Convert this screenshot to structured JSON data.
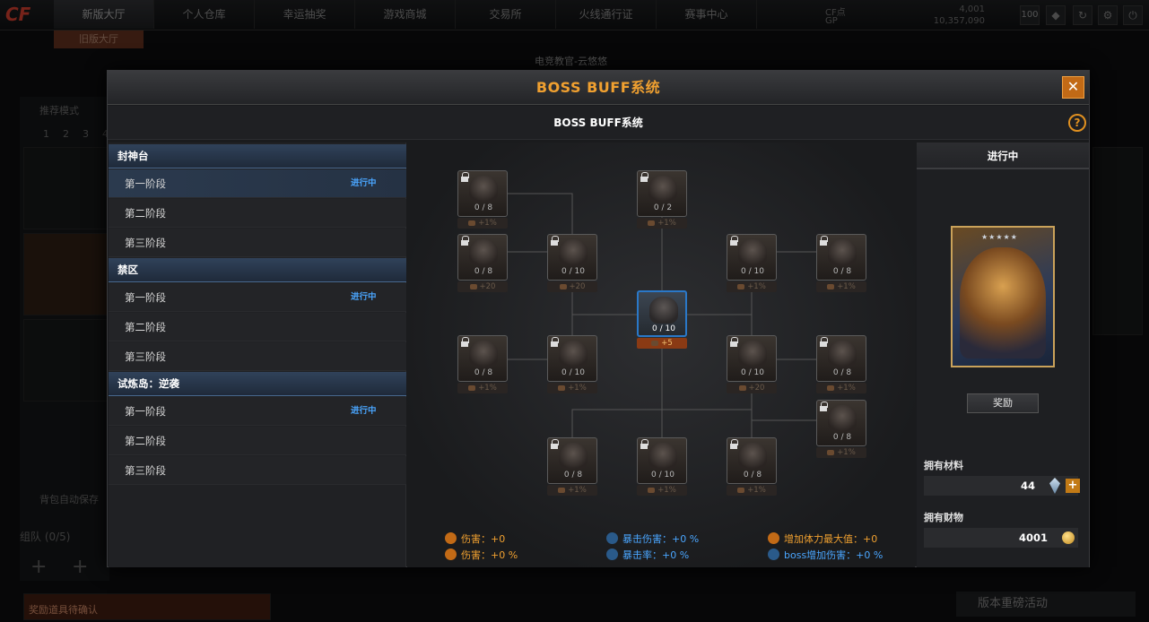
{
  "lobby": {
    "logo": "CF",
    "nav": [
      "新版大厅",
      "个人仓库",
      "幸运抽奖",
      "游戏商城",
      "交易所",
      "火线通行证",
      "赛事中心"
    ],
    "sub_tab": "旧版大厅",
    "currency": {
      "cf_label": "CF点",
      "cf_value": "4,001",
      "gp_label": "GP",
      "gp_value": "10,357,090"
    },
    "level": "100",
    "broadcast": "电竞教官-云悠悠",
    "mode_label": "推荐模式",
    "pages": [
      "1",
      "2",
      "3",
      "4"
    ],
    "team_label": "组队 (0/5)",
    "auto_save": "背包自动保存",
    "reward_confirm": "奖励道具待确认",
    "banner": "版本重磅活动"
  },
  "dialog": {
    "title": "BOSS BUFF系统",
    "close_glyph": "✕",
    "sub_title": "BOSS BUFF系统",
    "help_glyph": "?"
  },
  "stage_groups": [
    {
      "name": "封神台",
      "stages": [
        {
          "label": "第一阶段",
          "status": "进行中"
        },
        {
          "label": "第二阶段",
          "status": ""
        },
        {
          "label": "第三阶段",
          "status": ""
        }
      ]
    },
    {
      "name": "禁区",
      "stages": [
        {
          "label": "第一阶段",
          "status": "进行中"
        },
        {
          "label": "第二阶段",
          "status": ""
        },
        {
          "label": "第三阶段",
          "status": ""
        }
      ]
    },
    {
      "name": "试炼岛：逆袭",
      "stages": [
        {
          "label": "第一阶段",
          "status": "进行中"
        },
        {
          "label": "第二阶段",
          "status": ""
        },
        {
          "label": "第三阶段",
          "status": ""
        }
      ]
    }
  ],
  "tree": {
    "nodes": [
      {
        "count": "0 / 8",
        "bonus": "+1%",
        "locked": true
      },
      {
        "count": "0 / 2",
        "bonus": "+1%",
        "locked": true
      },
      {
        "count": "0 / 8",
        "bonus": "+20",
        "locked": true
      },
      {
        "count": "0 / 10",
        "bonus": "+20",
        "locked": true
      },
      {
        "count": "0 / 10",
        "bonus": "+1%",
        "locked": true
      },
      {
        "count": "0 / 8",
        "bonus": "+1%",
        "locked": true
      },
      {
        "count": "0 / 10",
        "bonus": "+5",
        "locked": false
      },
      {
        "count": "0 / 8",
        "bonus": "+1%",
        "locked": true
      },
      {
        "count": "0 / 10",
        "bonus": "+1%",
        "locked": true
      },
      {
        "count": "0 / 10",
        "bonus": "+20",
        "locked": true
      },
      {
        "count": "0 / 8",
        "bonus": "+1%",
        "locked": true
      },
      {
        "count": "0 / 8",
        "bonus": "+1%",
        "locked": true
      },
      {
        "count": "0 / 8",
        "bonus": "+1%",
        "locked": true
      },
      {
        "count": "0 / 10",
        "bonus": "+1%",
        "locked": true
      },
      {
        "count": "0 / 8",
        "bonus": "+1%",
        "locked": true
      }
    ]
  },
  "stats": [
    {
      "label": "伤害：+0",
      "color": "orange",
      "icon": "damage-icon"
    },
    {
      "label": "伤害：+0 %",
      "color": "orange",
      "icon": "damage-percent-icon"
    },
    {
      "label": "暴击伤害：+0 %",
      "color": "blue",
      "icon": "crit-damage-icon"
    },
    {
      "label": "暴击率：+0 %",
      "color": "blue",
      "icon": "crit-rate-icon"
    },
    {
      "label": "增加体力最大值：+0",
      "color": "orange",
      "icon": "max-hp-icon"
    },
    {
      "label": "boss增加伤害：+0 %",
      "color": "blue",
      "icon": "boss-damage-icon"
    }
  ],
  "right_panel": {
    "status": "进行中",
    "boss_stars": "★★★★★",
    "reward_label": "奖励",
    "materials_label": "拥有材料",
    "materials_value": "44",
    "wealth_label": "拥有财物",
    "wealth_value": "4001"
  },
  "colors": {
    "accent": "#f0a030",
    "blue": "#4aa6ff",
    "active_border": "#2a78c8"
  }
}
